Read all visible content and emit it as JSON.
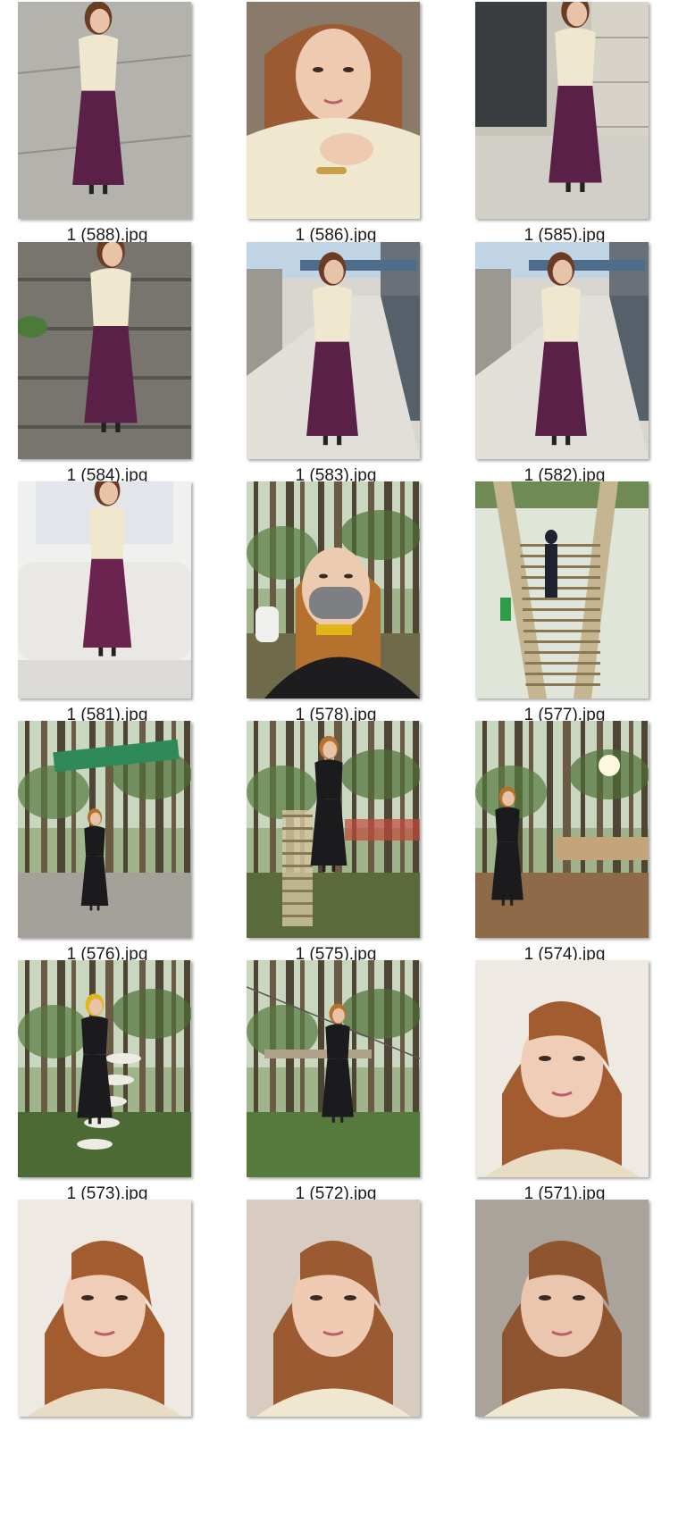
{
  "files": [
    {
      "name": "1 (588).jpg",
      "scene": "wall-outfit"
    },
    {
      "name": "1 (586).jpg",
      "scene": "portrait-sweater"
    },
    {
      "name": "1 (585).jpg",
      "scene": "building-outfit"
    },
    {
      "name": "1 (584).jpg",
      "scene": "stone-steps-outfit"
    },
    {
      "name": "1 (583).jpg",
      "scene": "canal-outfit"
    },
    {
      "name": "1 (582).jpg",
      "scene": "canal-outfit"
    },
    {
      "name": "1 (581).jpg",
      "scene": "white-sofa-outfit"
    },
    {
      "name": "1 (578).jpg",
      "scene": "forest-selfie-mask"
    },
    {
      "name": "1 (577).jpg",
      "scene": "wooden-stairs"
    },
    {
      "name": "1 (576).jpg",
      "scene": "forest-sign-gravel"
    },
    {
      "name": "1 (575).jpg",
      "scene": "forest-ladder"
    },
    {
      "name": "1 (574).jpg",
      "scene": "forest-ground"
    },
    {
      "name": "1 (573).jpg",
      "scene": "forest-discs"
    },
    {
      "name": "1 (572).jpg",
      "scene": "forest-ropes"
    },
    {
      "name": "1 (571).jpg",
      "scene": "portrait-indoor"
    },
    {
      "name": "",
      "scene": "portrait-indoor"
    },
    {
      "name": "",
      "scene": "portrait-room"
    },
    {
      "name": "",
      "scene": "portrait-room-dark"
    }
  ],
  "colors": {
    "caption_text": "#1a1a1a",
    "background": "#ffffff"
  }
}
